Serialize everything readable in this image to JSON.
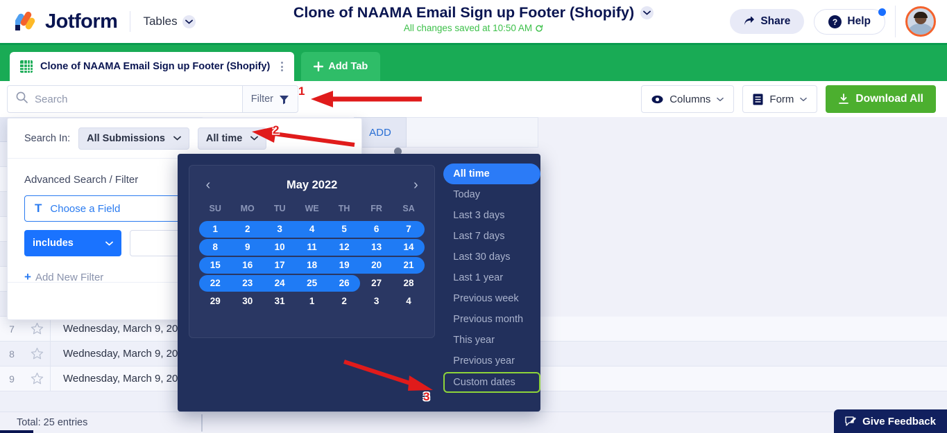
{
  "header": {
    "brand": "Jotform",
    "nav_label": "Tables",
    "form_title": "Clone of NAAMA Email Sign up Footer (Shopify)",
    "saved_status": "All changes saved at 10:50 AM",
    "share_label": "Share",
    "help_label": "Help"
  },
  "tabbar": {
    "tab_label": "Clone of NAAMA Email Sign up Footer (Shopify)",
    "add_tab_label": "Add Tab"
  },
  "toolbar": {
    "search_placeholder": "Search",
    "search_value": "",
    "filter_label": "Filter",
    "columns_label": "Columns",
    "form_label": "Form",
    "download_label": "Download All"
  },
  "filter_panel": {
    "search_in_label": "Search In:",
    "submissions_value": "All Submissions",
    "time_value": "All time",
    "advanced_title": "Advanced Search / Filter",
    "choose_field_label": "Choose a Field",
    "condition_value": "includes",
    "condition_input": "",
    "add_new_filter_label": "Add New Filter"
  },
  "datepicker": {
    "month_title": "May 2022",
    "prev_label": "‹",
    "next_label": "›",
    "dow": [
      "SU",
      "MO",
      "TU",
      "WE",
      "TH",
      "FR",
      "SA"
    ],
    "weeks": [
      [
        "1",
        "2",
        "3",
        "4",
        "5",
        "6",
        "7"
      ],
      [
        "8",
        "9",
        "10",
        "11",
        "12",
        "13",
        "14"
      ],
      [
        "15",
        "16",
        "17",
        "18",
        "19",
        "20",
        "21"
      ],
      [
        "22",
        "23",
        "24",
        "25",
        "26",
        "27",
        "28"
      ],
      [
        "29",
        "30",
        "31",
        "1",
        "2",
        "3",
        "4"
      ]
    ],
    "ranges": [
      "All time",
      "Today",
      "Last 3 days",
      "Last 7 days",
      "Last 30 days",
      "Last 1 year",
      "Previous week",
      "Previous month",
      "This year",
      "Previous year",
      "Custom dates"
    ],
    "active_range": "All time",
    "highlighted_range": "Custom dates"
  },
  "table": {
    "header_add_label": "ADD",
    "rows": [
      {
        "index": "7",
        "date": "Wednesday, March 9, 202"
      },
      {
        "index": "8",
        "date": "Wednesday, March 9, 202"
      },
      {
        "index": "9",
        "date": "Wednesday, March 9, 202"
      }
    ],
    "total_label": "Total: 25 entries"
  },
  "annotations": {
    "step1": "1",
    "step2": "2",
    "step3": "3"
  },
  "feedback": {
    "label": "Give Feedback"
  },
  "colors": {
    "brand_navy": "#0a1551",
    "green_bar": "#19ab55",
    "download_green": "#4caf2f",
    "accent_blue": "#1a73ff",
    "popover_navy": "#22305c",
    "highlight_green": "#8ed43a",
    "arrow_red": "#e01b1b",
    "saved_green": "#3dc04a"
  }
}
